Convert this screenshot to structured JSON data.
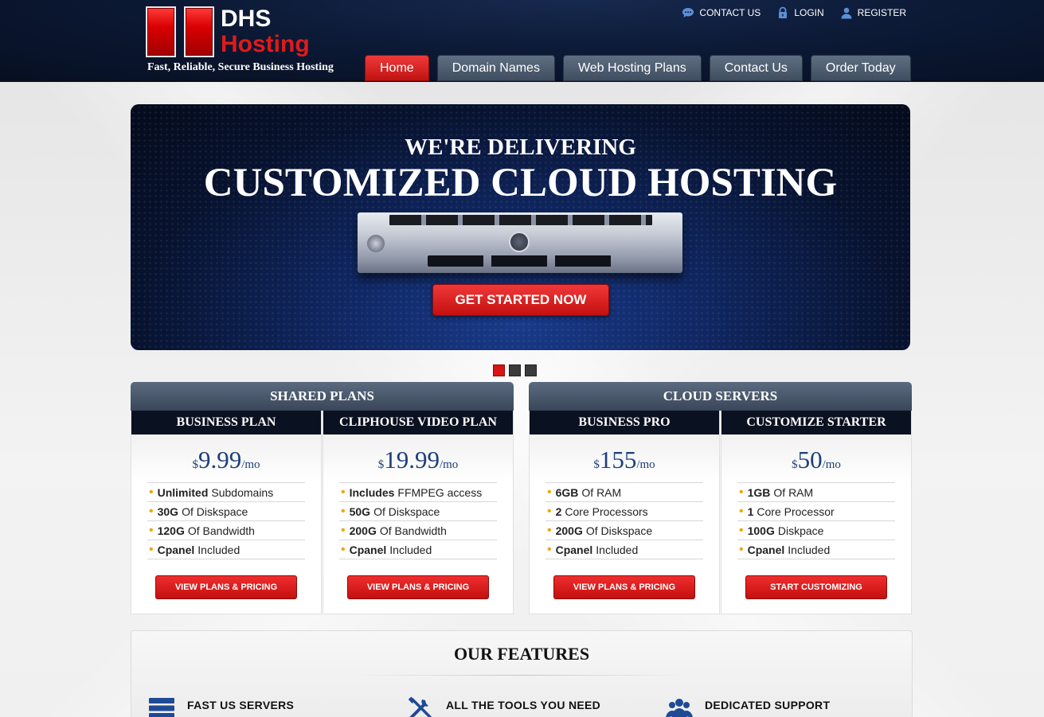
{
  "logo": {
    "line1": "DHS",
    "line2": "Hosting",
    "tagline": "Fast, Reliable, Secure Business Hosting"
  },
  "top_links": [
    {
      "label": "CONTACT US",
      "icon": "chat-icon"
    },
    {
      "label": "LOGIN",
      "icon": "lock-icon"
    },
    {
      "label": "REGISTER",
      "icon": "user-icon"
    }
  ],
  "nav": [
    {
      "label": "Home",
      "active": true
    },
    {
      "label": "Domain Names"
    },
    {
      "label": "Web Hosting Plans"
    },
    {
      "label": "Contact Us"
    },
    {
      "label": "Order Today"
    }
  ],
  "hero": {
    "line1": "WE'RE DELIVERING",
    "line2": "CUSTOMIZED CLOUD HOSTING",
    "cta": "GET STARTED NOW",
    "slides": 3,
    "active_slide": 1
  },
  "groups": [
    {
      "title": "SHARED PLANS",
      "plans": [
        {
          "name": "BUSINESS PLAN",
          "currency": "$",
          "amount": "9.99",
          "per": "/mo",
          "features": [
            {
              "bold": "Unlimited",
              "text": "Subdomains"
            },
            {
              "bold": "30G",
              "text": "Of Diskspace"
            },
            {
              "bold": "120G",
              "text": "Of Bandwidth"
            },
            {
              "bold": "Cpanel",
              "text": "Included"
            }
          ],
          "button": "VIEW PLANS & PRICING"
        },
        {
          "name": "CLIPHOUSE VIDEO PLAN",
          "currency": "$",
          "amount": "19.99",
          "per": "/mo",
          "features": [
            {
              "bold": "Includes",
              "text": "FFMPEG access"
            },
            {
              "bold": "50G",
              "text": "Of Diskspace"
            },
            {
              "bold": "200G",
              "text": "Of Bandwidth"
            },
            {
              "bold": "Cpanel",
              "text": "Included"
            }
          ],
          "button": "VIEW PLANS & PRICING"
        }
      ]
    },
    {
      "title": "CLOUD SERVERS",
      "plans": [
        {
          "name": "BUSINESS PRO",
          "currency": "$",
          "amount": "155",
          "per": "/mo",
          "features": [
            {
              "bold": "6GB",
              "text": "Of RAM"
            },
            {
              "bold": "2",
              "text": "Core Processors"
            },
            {
              "bold": "200G",
              "text": "Of Diskspace"
            },
            {
              "bold": "Cpanel",
              "text": "Included"
            }
          ],
          "button": "VIEW PLANS & PRICING"
        },
        {
          "name": "CUSTOMIZE STARTER",
          "currency": "$",
          "amount": "50",
          "per": "/mo",
          "features": [
            {
              "bold": "1GB",
              "text": "Of RAM"
            },
            {
              "bold": "1",
              "text": "Core Processor"
            },
            {
              "bold": "100G",
              "text": "Diskpace"
            },
            {
              "bold": "Cpanel",
              "text": "Included"
            }
          ],
          "button": "START CUSTOMIZING"
        }
      ]
    }
  ],
  "features_section": {
    "title": "OUR FEATURES",
    "items": [
      {
        "label": "FAST US SERVERS",
        "icon": "server-stack-icon"
      },
      {
        "label": "ALL THE TOOLS YOU NEED",
        "icon": "tools-icon"
      },
      {
        "label": "DEDICATED SUPPORT",
        "icon": "people-icon"
      }
    ]
  },
  "colors": {
    "accent_red": "#d81414",
    "header_navy": "#0c1a36",
    "price_blue": "#1d3f7a",
    "bullet_gold": "#f0a500"
  }
}
